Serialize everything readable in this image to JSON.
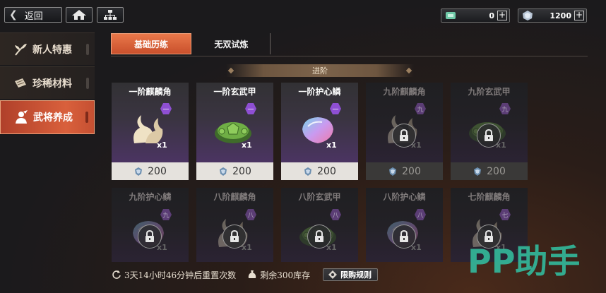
{
  "top_bar": {
    "back_label": "返回",
    "icons": [
      "back-chevron-icon",
      "home-icon",
      "hierarchy-icon"
    ],
    "currencies": [
      {
        "icon": "green-ticket-icon",
        "value": "0"
      },
      {
        "icon": "silver-scale-icon",
        "value": "1200"
      }
    ]
  },
  "sidebar": {
    "items": [
      {
        "label": "新人特惠",
        "icon": "sprout-icon",
        "active": false
      },
      {
        "label": "珍稀材料",
        "icon": "scroll-icon",
        "active": false
      },
      {
        "label": "武将养成",
        "icon": "general-icon",
        "active": true
      }
    ]
  },
  "tabs": [
    {
      "label": "基础历练",
      "active": true
    },
    {
      "label": "无双试炼",
      "active": false
    }
  ],
  "section_header": "进阶",
  "cards": [
    {
      "name": "一阶麒麟角",
      "badge": "一",
      "qty": "x1",
      "price": "200",
      "locked": false,
      "item": "horn-icon"
    },
    {
      "name": "一阶玄武甲",
      "badge": "一",
      "qty": "x1",
      "price": "200",
      "locked": false,
      "item": "turtle-shell-icon"
    },
    {
      "name": "一阶护心鳞",
      "badge": "一",
      "qty": "x1",
      "price": "200",
      "locked": false,
      "item": "scale-icon"
    },
    {
      "name": "九阶麒麟角",
      "badge": "九",
      "qty": "x1",
      "price": "200",
      "locked": true,
      "item": "horn-icon"
    },
    {
      "name": "九阶玄武甲",
      "badge": "九",
      "qty": "x1",
      "price": "200",
      "locked": true,
      "item": "turtle-shell-icon"
    },
    {
      "name": "九阶护心鳞",
      "badge": "九",
      "qty": "x1",
      "locked": true,
      "item": "scale-icon"
    },
    {
      "name": "八阶麒麟角",
      "badge": "八",
      "qty": "x1",
      "locked": true,
      "item": "horn-icon"
    },
    {
      "name": "八阶玄武甲",
      "badge": "八",
      "qty": "x1",
      "locked": true,
      "item": "turtle-shell-icon"
    },
    {
      "name": "八阶护心鳞",
      "badge": "八",
      "qty": "x1",
      "locked": true,
      "item": "scale-icon"
    },
    {
      "name": "七阶麒麟角",
      "badge": "七",
      "qty": "x1",
      "locked": true,
      "item": "horn-icon"
    }
  ],
  "footer": {
    "refresh_text": "3天14小时46分钟后重置次数",
    "stock_text": "剩余300库存",
    "limit_rules_label": "限购规则"
  },
  "watermark": "PP助手",
  "colors": {
    "accent_orange": "#d9603c",
    "badge_purple": "#8e4fd3",
    "watermark_green": "#33b79a"
  }
}
